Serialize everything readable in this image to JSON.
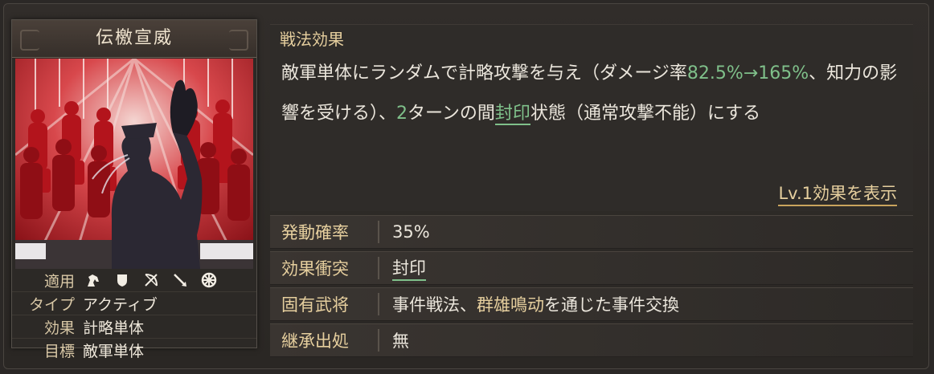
{
  "card": {
    "title": "伝檄宣威",
    "attributes": [
      {
        "label": "適用",
        "value": ""
      },
      {
        "label": "タイプ",
        "value": "アクティブ"
      },
      {
        "label": "効果",
        "value": "計略単体"
      },
      {
        "label": "目標",
        "value": "敵軍単体"
      }
    ],
    "troop_icons": [
      "cavalry-icon",
      "shield-icon",
      "bow-icon",
      "spear-icon",
      "chariot-wheel-icon"
    ]
  },
  "effect": {
    "heading": "戦法効果",
    "text_1": "敵軍単体にランダムで計略攻撃を与え（ダメージ率",
    "damage_rate": "82.5%→165%",
    "text_2": "、知力の影響を受ける）、",
    "turns": "2",
    "text_3": "ターンの間",
    "status_link": "封印",
    "text_4": "状態（通常攻撃不能）にする",
    "lv_link": "Lv.1効果を表示"
  },
  "info": {
    "activation_label": "発動確率",
    "activation_value": "35%",
    "conflict_label": "効果衝突",
    "conflict_value": "封印",
    "unique_label": "固有武将",
    "unique_value_1": "事件戦法、",
    "unique_value_event": "群雄鳴动",
    "unique_value_2": "を通じた事件交換",
    "inherit_label": "継承出処",
    "inherit_value": "無"
  },
  "colors": {
    "accent_gold": "#e6cf9e",
    "highlight_green": "#7fc08a",
    "art_red": "#c8202a"
  }
}
